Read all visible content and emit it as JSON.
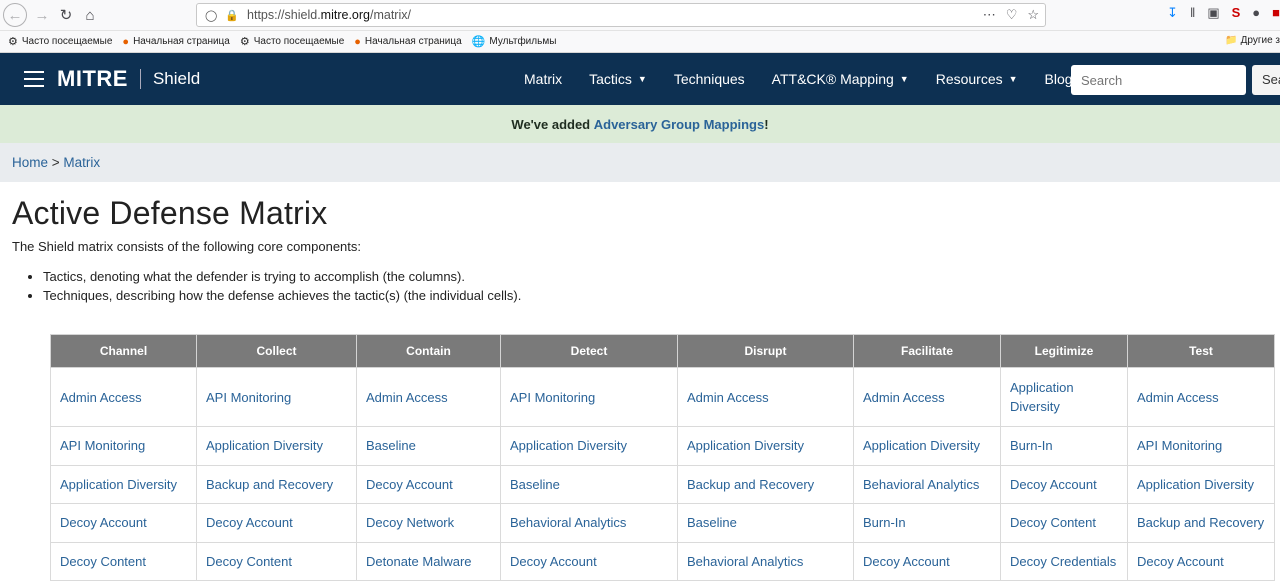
{
  "browser": {
    "url_prefix": "https://shield.",
    "url_domain": "mitre.org",
    "url_path": "/matrix/",
    "bookmarks": [
      "Часто посещаемые",
      "Начальная страница",
      "Часто посещаемые",
      "Начальная страница",
      "Мультфильмы"
    ],
    "bookmarks_other": "Другие з"
  },
  "navbar": {
    "logo": "MITRE",
    "product": "Shield",
    "links": [
      {
        "label": "Matrix",
        "dropdown": false
      },
      {
        "label": "Tactics",
        "dropdown": true
      },
      {
        "label": "Techniques",
        "dropdown": false
      },
      {
        "label": "ATT&CK® Mapping",
        "dropdown": true
      },
      {
        "label": "Resources",
        "dropdown": true
      },
      {
        "label": "Blog",
        "dropdown": false
      }
    ],
    "search_placeholder": "Search",
    "search_button": "Search"
  },
  "announcement": {
    "prefix": "We've added ",
    "link": "Adversary Group Mappings",
    "suffix": "!"
  },
  "breadcrumb": {
    "home": "Home",
    "separator": " > ",
    "current": "Matrix"
  },
  "page": {
    "title": "Active Defense Matrix",
    "intro": "The Shield matrix consists of the following core components:",
    "bullets": [
      "Tactics, denoting what the defender is trying to accomplish (the columns).",
      "Techniques, describing how the defense achieves the tactic(s) (the individual cells)."
    ]
  },
  "matrix": {
    "columns": [
      "Channel",
      "Collect",
      "Contain",
      "Detect",
      "Disrupt",
      "Facilitate",
      "Legitimize",
      "Test"
    ],
    "rows": [
      [
        "Admin Access",
        "API Monitoring",
        "Admin Access",
        "API Monitoring",
        "Admin Access",
        "Admin Access",
        "Application Diversity",
        "Admin Access"
      ],
      [
        "API Monitoring",
        "Application Diversity",
        "Baseline",
        "Application Diversity",
        "Application Diversity",
        "Application Diversity",
        "Burn-In",
        "API Monitoring"
      ],
      [
        "Application Diversity",
        "Backup and Recovery",
        "Decoy Account",
        "Baseline",
        "Backup and Recovery",
        "Behavioral Analytics",
        "Decoy Account",
        "Application Diversity"
      ],
      [
        "Decoy Account",
        "Decoy Account",
        "Decoy Network",
        "Behavioral Analytics",
        "Baseline",
        "Burn-In",
        "Decoy Content",
        "Backup and Recovery"
      ],
      [
        "Decoy Content",
        "Decoy Content",
        "Detonate Malware",
        "Decoy Account",
        "Behavioral Analytics",
        "Decoy Account",
        "Decoy Credentials",
        "Decoy Account"
      ]
    ]
  },
  "colors": {
    "navbar_bg": "#0d3052",
    "announce_bg": "#dcebd7",
    "breadcrumb_bg": "#e9ecef",
    "link": "#2a6398",
    "table_header_bg": "#7a7a7a"
  }
}
